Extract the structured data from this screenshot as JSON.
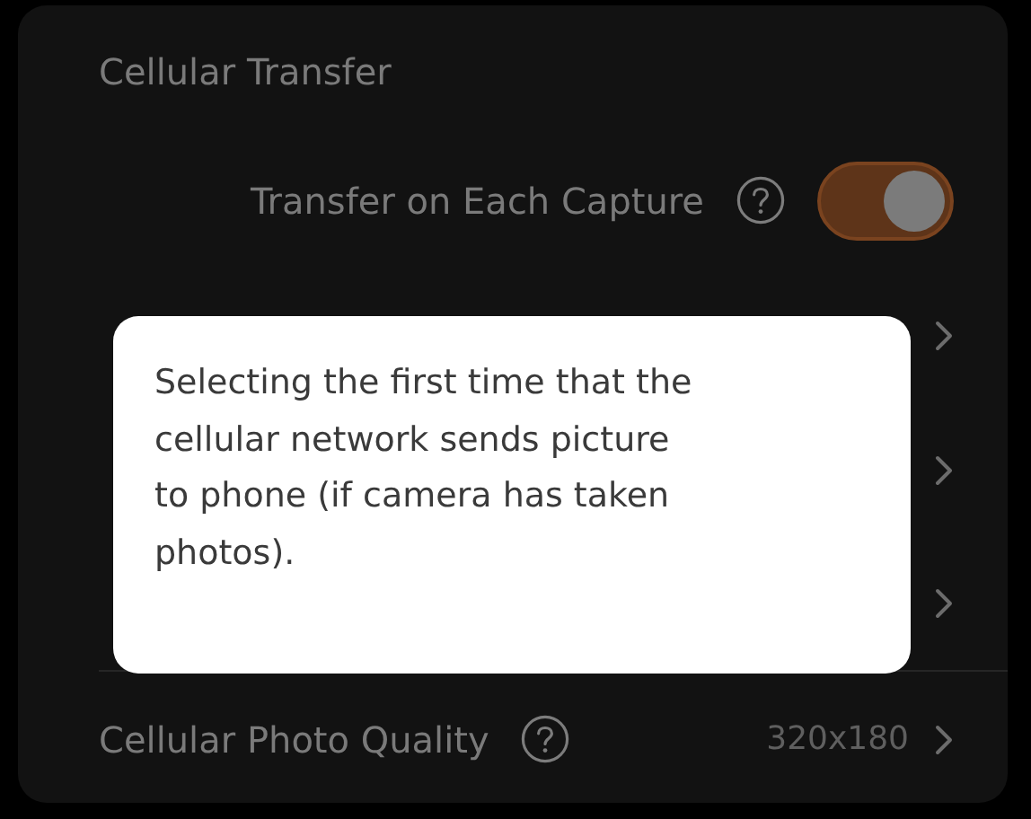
{
  "section": {
    "title": "Cellular Transfer"
  },
  "rows": [
    {
      "kind": "toggle",
      "label": "Transfer on Each Capture",
      "help": true,
      "on": true
    },
    {
      "kind": "link"
    },
    {
      "kind": "link"
    },
    {
      "kind": "link"
    },
    {
      "kind": "value",
      "label": "Cellular Photo Quality",
      "help": true,
      "value": "320x180"
    }
  ],
  "tooltip": {
    "lines": [
      "Selecting the first time that the",
      "cellular network sends picture",
      "to phone (if camera has taken",
      "photos)."
    ]
  }
}
